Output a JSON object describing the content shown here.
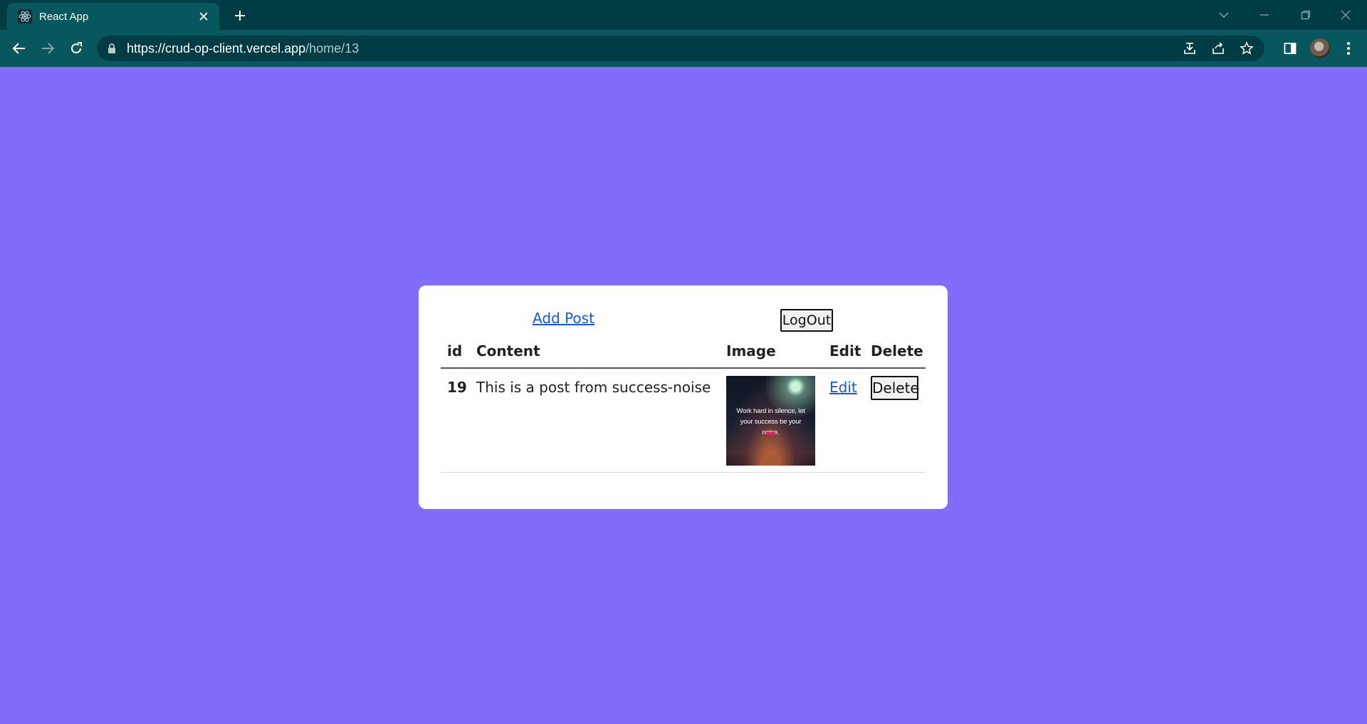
{
  "browser": {
    "tab_title": "React App",
    "url_host": "https://crud-op-client.vercel.app",
    "url_path": "/home/13"
  },
  "page": {
    "add_post_label": "Add Post",
    "logout_label": "LogOut",
    "table": {
      "headers": [
        "id",
        "Content",
        "Image",
        "Edit",
        "Delete"
      ],
      "rows": [
        {
          "id": "19",
          "content": "This is a post from success-noise",
          "image_caption": "Work hard in silence, let your success be your noise.",
          "edit_label": "Edit",
          "delete_label": "Delete"
        }
      ]
    }
  },
  "colors": {
    "page_background": "#826cfb",
    "link": "#1a56d6",
    "browser_frame": "#003c43",
    "browser_toolbar": "#08575e"
  }
}
